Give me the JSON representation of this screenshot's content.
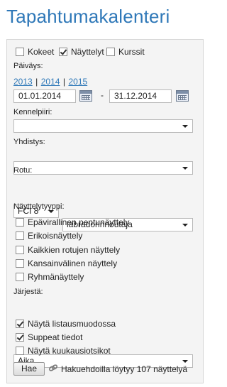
{
  "title": "Tapahtumakalenteri",
  "event_types": [
    {
      "label": "Kokeet",
      "checked": false
    },
    {
      "label": "Näyttelyt",
      "checked": true
    },
    {
      "label": "Kurssit",
      "checked": false
    }
  ],
  "date": {
    "label": "Päiväys:",
    "years": [
      "2013",
      "2014",
      "2015"
    ],
    "separator": "|",
    "start": "01.01.2014",
    "end": "31.12.2014",
    "dash": "-"
  },
  "kennelpiiri": {
    "label": "Kennelpiiri:",
    "value": ""
  },
  "yhdistys": {
    "label": "Yhdistys:",
    "value": ""
  },
  "rotu": {
    "label": "Rotu:",
    "group": "FCI 8",
    "breed": "labradorinnoutaja"
  },
  "show_types": {
    "label": "Näyttelytyyppi:",
    "items": [
      {
        "label": "Epävirallinen pentunäyttely",
        "checked": false
      },
      {
        "label": "Erikoisnäyttely",
        "checked": false
      },
      {
        "label": "Kaikkien rotujen näyttely",
        "checked": false
      },
      {
        "label": "Kansainvälinen näyttely",
        "checked": false
      },
      {
        "label": "Ryhmänäyttely",
        "checked": false
      }
    ]
  },
  "sort": {
    "label": "Järjestä:",
    "value": "Aika"
  },
  "options": [
    {
      "label": "Näytä listausmuodossa",
      "checked": true
    },
    {
      "label": "Suppeat tiedot",
      "checked": true
    },
    {
      "label": "Näytä kuukausiotsikot",
      "checked": false
    }
  ],
  "search": {
    "button": "Hae",
    "result": "Hakuehdoilla löytyy 107 näyttelyä"
  },
  "icons": {
    "calendar": "calendar-icon",
    "link": "link-icon",
    "dropdown": "chevron-down-icon"
  }
}
